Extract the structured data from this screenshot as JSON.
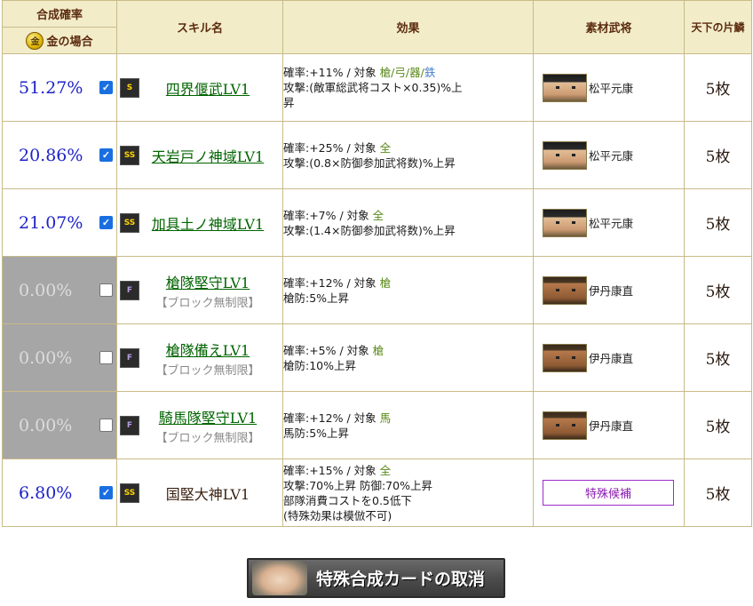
{
  "header": {
    "rate": "合成確率",
    "gold_case": "金の場合",
    "gold_coin": "金",
    "skill_name": "スキル名",
    "effect": "効果",
    "material": "素材武将",
    "tenka": "天下の片鱗"
  },
  "rows": [
    {
      "rate": "51.27%",
      "checked": true,
      "rank": "S",
      "skill": "四界偃武LV1",
      "block": "",
      "effect_rate": "確率:+11% / 対象 ",
      "targets": [
        "槍",
        "弓",
        "器",
        "鉄"
      ],
      "effect_lines": [
        "攻撃:(敵軍総武将コスト×0.35)%上",
        "昇"
      ],
      "material": "松平元康",
      "count": "5枚"
    },
    {
      "rate": "20.86%",
      "checked": true,
      "rank": "SS",
      "skill": "天岩戸ノ神域LV1",
      "block": "",
      "effect_rate": "確率:+25% / 対象 ",
      "targets": [
        "全"
      ],
      "effect_lines": [
        "攻撃:(0.8×防御参加武将数)%上昇"
      ],
      "material": "松平元康",
      "count": "5枚"
    },
    {
      "rate": "21.07%",
      "checked": true,
      "rank": "SS",
      "skill": "加具土ノ神域LV1",
      "block": "",
      "effect_rate": "確率:+7% / 対象 ",
      "targets": [
        "全"
      ],
      "effect_lines": [
        "攻撃:(1.4×防御参加武将数)%上昇"
      ],
      "material": "松平元康",
      "count": "5枚"
    },
    {
      "rate": "0.00%",
      "checked": false,
      "rank": "F",
      "skill": "槍隊堅守LV1",
      "block": "【ブロック無制限】",
      "effect_rate": "確率:+12% / 対象 ",
      "targets": [
        "槍"
      ],
      "effect_lines": [
        "槍防:5%上昇"
      ],
      "material": "伊丹康直",
      "count": "5枚"
    },
    {
      "rate": "0.00%",
      "checked": false,
      "rank": "F",
      "skill": "槍隊備えLV1",
      "block": "【ブロック無制限】",
      "effect_rate": "確率:+5% / 対象 ",
      "targets": [
        "槍"
      ],
      "effect_lines": [
        "槍防:10%上昇"
      ],
      "material": "伊丹康直",
      "count": "5枚"
    },
    {
      "rate": "0.00%",
      "checked": false,
      "rank": "F",
      "skill": "騎馬隊堅守LV1",
      "block": "【ブロック無制限】",
      "effect_rate": "確率:+12% / 対象 ",
      "targets": [
        "馬"
      ],
      "effect_lines": [
        "馬防:5%上昇"
      ],
      "material": "伊丹康直",
      "count": "5枚"
    },
    {
      "rate": "6.80%",
      "checked": true,
      "rank": "SS",
      "skill": "国堅大神LV1",
      "block": "",
      "effect_rate": "確率:+15% / 対象 ",
      "targets": [
        "全"
      ],
      "effect_lines": [
        "攻撃:70%上昇 防御:70%上昇",
        "部隊消費コストを0.5低下",
        "(特殊効果は模倣不可)"
      ],
      "material": "特殊候補",
      "special": true,
      "count": "5枚"
    }
  ],
  "cancel_button": "特殊合成カードの取消"
}
